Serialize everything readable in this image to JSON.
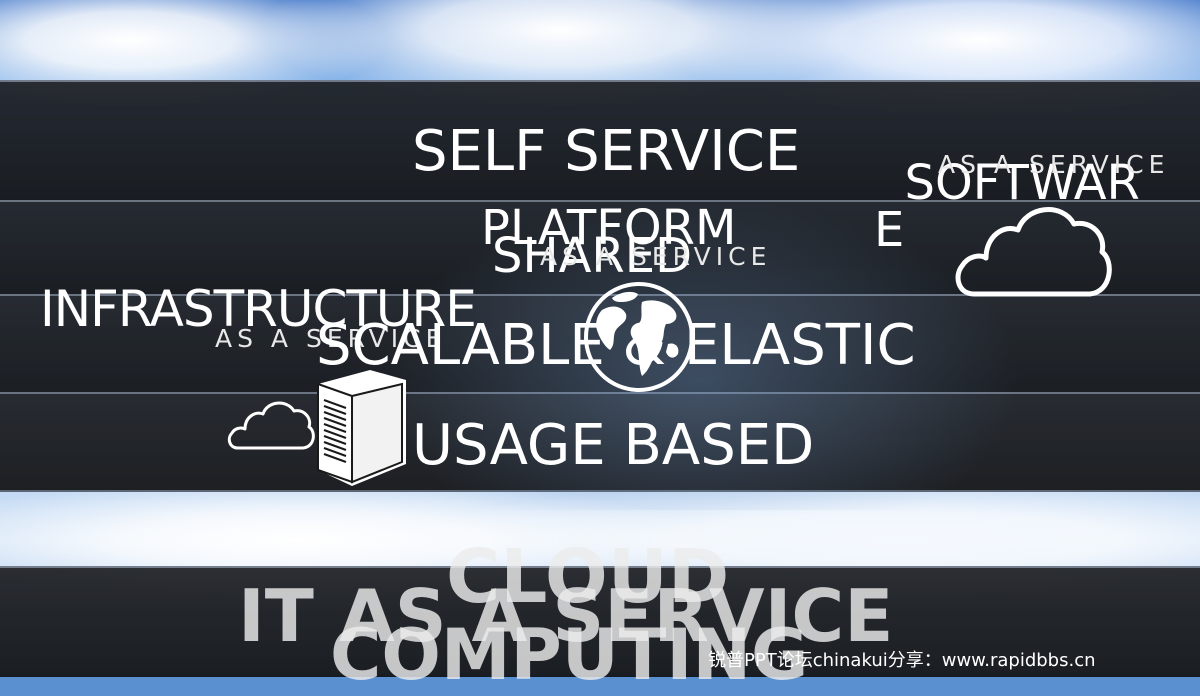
{
  "slide": {
    "concepts": {
      "self_service": "SELF SERVICE",
      "shared": "SHARED",
      "scalable_elastic": "SCALABLE & ELASTIC",
      "usage_based": "USAGE BASED"
    },
    "service_models": {
      "software": "SOFTWAR\nE",
      "software_sub": "AS A SERVICE",
      "platform": "PLATFORM",
      "platform_sub": "AS A SERVICE",
      "infrastructure": "INFRASTRUCTURE",
      "infrastructure_sub": "AS A SERVICE"
    },
    "bottom_titles": {
      "cloud": "CLOUD",
      "it_as_a_service": "IT AS A SERVICE",
      "computing": "COMPUTING"
    },
    "watermark": "锐普PPT论坛chinakui分享：www.rapidbbs.cn",
    "icons": [
      "cloud-outline-icon",
      "cloud-outline-small-icon",
      "globe-icon",
      "server-tower-icon"
    ]
  }
}
